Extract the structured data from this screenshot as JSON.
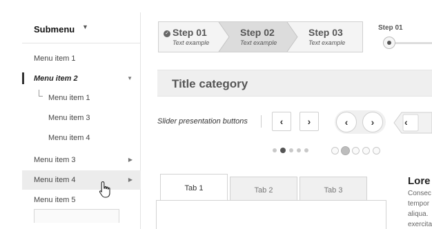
{
  "sidebar": {
    "header": "Submenu",
    "items": [
      {
        "label": "Menu item 1"
      },
      {
        "label": "Menu item 2"
      },
      {
        "label": "Menu item 1"
      },
      {
        "label": "Menu item 3"
      },
      {
        "label": "Menu item 4"
      },
      {
        "label": "Menu item 3"
      },
      {
        "label": "Menu item 4"
      },
      {
        "label": "Menu item 5"
      }
    ]
  },
  "stepper": {
    "steps": [
      {
        "title": "Step 01",
        "subtitle": "Text example",
        "state": "done"
      },
      {
        "title": "Step 02",
        "subtitle": "Text example",
        "state": "current"
      },
      {
        "title": "Step 03",
        "subtitle": "Text example",
        "state": "upcoming"
      }
    ]
  },
  "right_step": {
    "label": "Step 01"
  },
  "title_category": {
    "text": "Title category"
  },
  "slider_buttons": {
    "label": "Slider presentation buttons",
    "prev_glyph": "‹",
    "next_glyph": "›"
  },
  "tabs": [
    {
      "label": "Tab 1",
      "active": true
    },
    {
      "label": "Tab 2",
      "active": false
    },
    {
      "label": "Tab 3",
      "active": false
    }
  ],
  "lorem": {
    "title": "Lore",
    "lines": [
      "Consec",
      "tempor",
      "aliqua.",
      "exercita"
    ]
  },
  "colors": {
    "accent": "#555555",
    "step_current_bg": "#dcdcdc",
    "title_bar_bg": "#efefef"
  }
}
